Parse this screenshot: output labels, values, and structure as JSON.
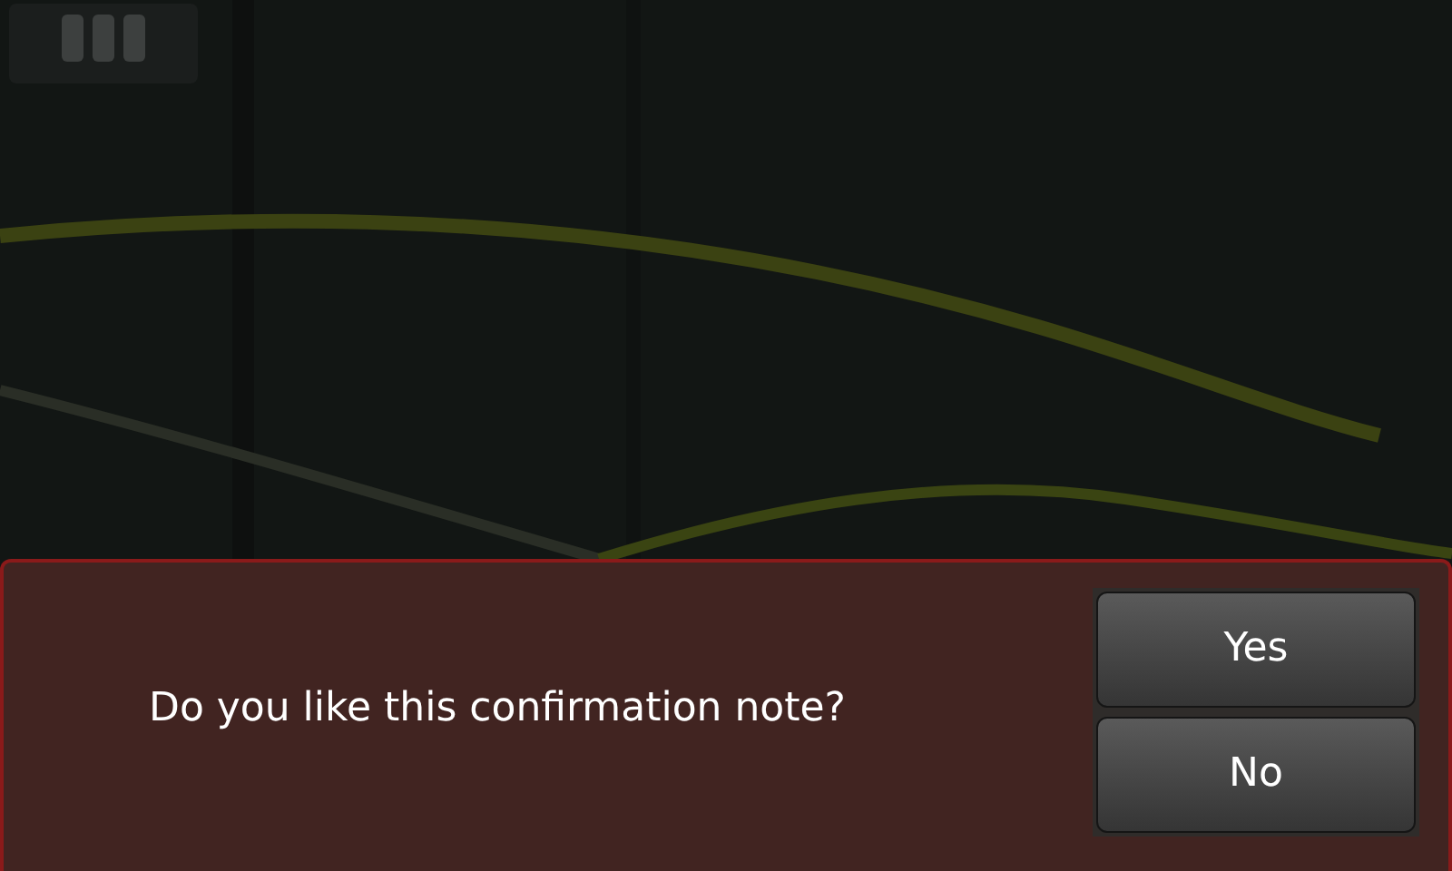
{
  "dialog": {
    "message": "Do you like this confirmation note?",
    "buttons": [
      {
        "label": "Yes"
      },
      {
        "label": "No"
      }
    ]
  }
}
